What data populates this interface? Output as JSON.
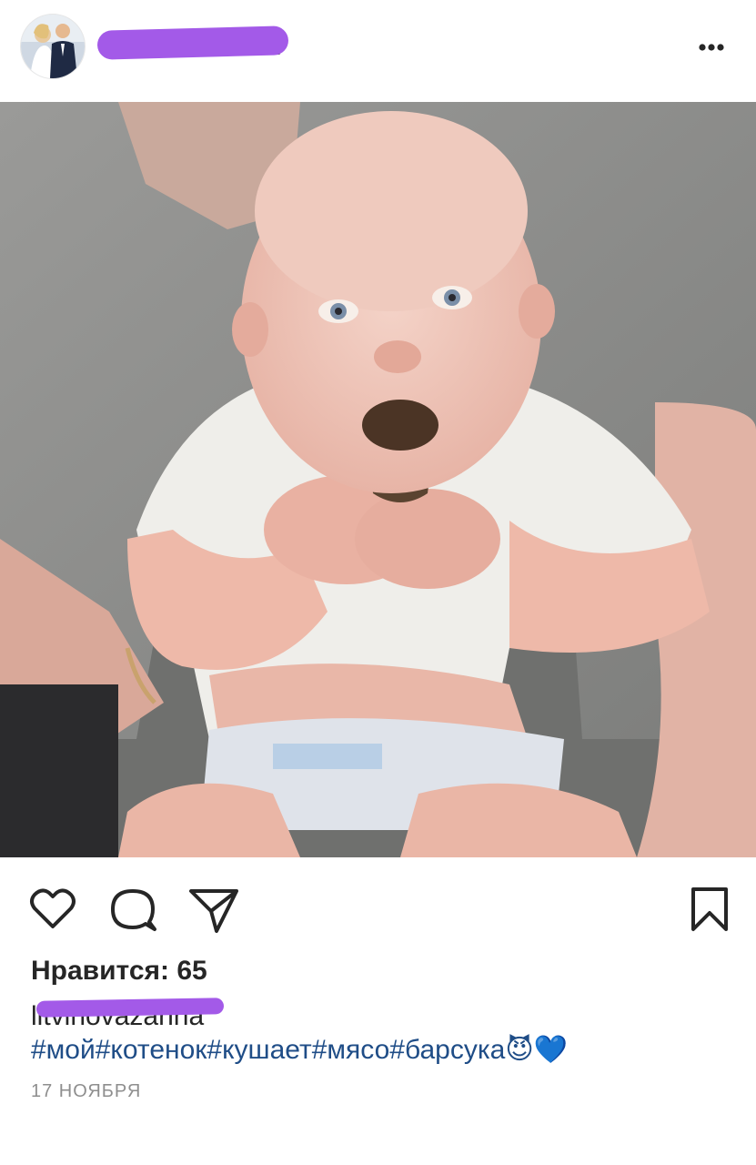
{
  "post": {
    "username": "litvinovazanna",
    "likes_label": "Нравится: 65",
    "caption_user": "litvinovazanna",
    "caption_text": "#мой#котенок#кушает#мясо#барсука",
    "caption_emoji": "😈💙",
    "date": "17 НОЯБРЯ"
  },
  "icons": {
    "more": "more-options-icon",
    "like": "heart-icon",
    "comment": "comment-icon",
    "share": "share-icon",
    "save": "bookmark-icon"
  },
  "colors": {
    "hashtag": "#1f4d87",
    "redaction": "#a35ae8",
    "text": "#262626",
    "muted": "#8e8e8e"
  }
}
